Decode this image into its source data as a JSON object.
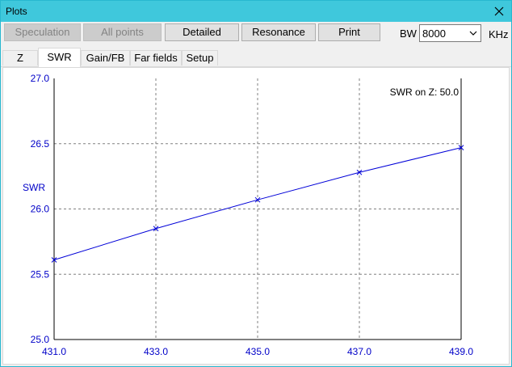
{
  "window": {
    "title": "Plots"
  },
  "toolbar": {
    "buttons": [
      {
        "label": "Speculation",
        "enabled": false
      },
      {
        "label": "All points",
        "enabled": false
      },
      {
        "label": "Detailed",
        "enabled": true
      },
      {
        "label": "Resonance",
        "enabled": true
      },
      {
        "label": "Print",
        "enabled": true
      }
    ],
    "bw_label": "BW",
    "bw_value": "8000",
    "unit_label": "KHz"
  },
  "tabs": [
    {
      "label": "Z",
      "active": false
    },
    {
      "label": "SWR",
      "active": true
    },
    {
      "label": "Gain/FB",
      "active": false
    },
    {
      "label": "Far fields",
      "active": false
    },
    {
      "label": "Setup",
      "active": false
    }
  ],
  "chart_data": {
    "type": "line",
    "title": "",
    "annotation": "SWR on Z: 50.0",
    "xlabel": "",
    "ylabel": "SWR",
    "xlim": [
      431.0,
      439.0
    ],
    "ylim": [
      25.0,
      27.0
    ],
    "x_ticks": [
      "431.0",
      "433.0",
      "435.0",
      "437.0",
      "439.0"
    ],
    "y_ticks": [
      "27.0",
      "26.5",
      "26.0",
      "25.5",
      "25.0"
    ],
    "grid": true,
    "series": [
      {
        "x": [
          431.0,
          433.0,
          435.0,
          437.0,
          439.0
        ],
        "y": [
          25.61,
          25.85,
          26.07,
          26.28,
          26.47
        ]
      }
    ],
    "colors": {
      "line": "#0000d8",
      "axis_text": "#0000c8",
      "grid": "#808080"
    }
  }
}
